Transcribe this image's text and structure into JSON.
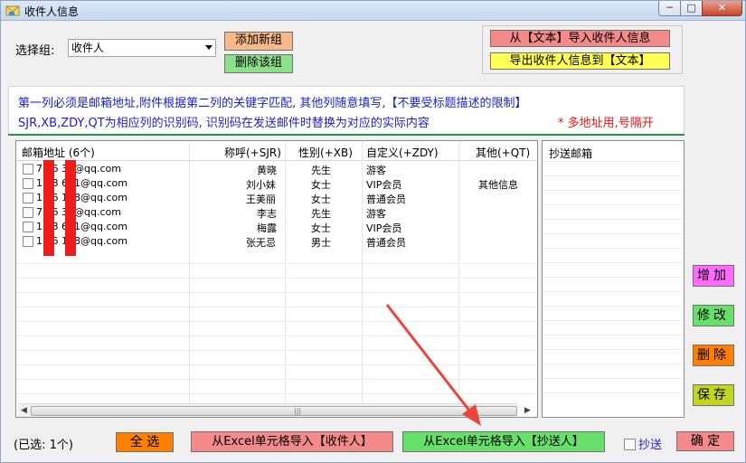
{
  "window": {
    "title": "收件人信息",
    "min": "─",
    "max": "□",
    "close": "✕"
  },
  "group": {
    "label": "选择组:",
    "value": "收件人"
  },
  "buttons": {
    "add_group": "添加新组",
    "delete_group": "删除该组",
    "import_text": "从【文本】导入收件人信息",
    "export_text": "导出收件人信息到【文本】",
    "select_all": "全 选",
    "import_excel_recipients": "从Excel单元格导入【收件人】",
    "import_excel_cc": "从Excel单元格导入【抄送人】",
    "confirm": "确 定",
    "side": {
      "add": "增加",
      "edit": "修改",
      "delete": "删除",
      "save": "保存"
    }
  },
  "info": {
    "line1": "第一列必须是邮箱地址,附件根据第二列的关键字匹配, 其他列随意填写,【不要受标题描述的限制】",
    "line2": "SJR,XB,ZDY,QT为相应列的识别码, 识别码在发送邮件时替换为对应的实际内容",
    "note": "* 多地址用,号隔开"
  },
  "table": {
    "headers": [
      "邮箱地址 (6个)",
      "称呼(+SJR)",
      "性别(+XB)",
      "自定义(+ZDY)",
      "其他(+QT)"
    ],
    "rows": [
      {
        "email": "7    96    35@qq.com",
        "name": "黄晓",
        "gender": "先生",
        "custom": "游客",
        "other": ""
      },
      {
        "email": "1    98    601@qq.com",
        "name": "刘小妹",
        "gender": "女士",
        "custom": "VIP会员",
        "other": "其他信息"
      },
      {
        "email": "1    26    138@qq.com",
        "name": "王美丽",
        "gender": "女士",
        "custom": "普通会员",
        "other": ""
      },
      {
        "email": "7    96    35@qq.com",
        "name": "李志",
        "gender": "先生",
        "custom": "游客",
        "other": ""
      },
      {
        "email": "1    98    601@qq.com",
        "name": "梅露",
        "gender": "女士",
        "custom": "VIP会员",
        "other": ""
      },
      {
        "email": "1    26    138@qq.com",
        "name": "张无忌",
        "gender": "男士",
        "custom": "普通会员",
        "other": ""
      }
    ],
    "scroll_left": "◀",
    "scroll_right": "▶",
    "scroll_grip": "|||"
  },
  "cc": {
    "header": "抄送邮箱"
  },
  "status": {
    "selected": "(已选: 1个)"
  },
  "cc_checkbox": {
    "label": "抄送"
  },
  "colors": {
    "arrow": "#e8453c",
    "info_text": "#1d1dcf",
    "note": "#e11111"
  },
  "icons": {
    "app": "envelope-icon",
    "arrow": "red-pointer-arrow"
  }
}
